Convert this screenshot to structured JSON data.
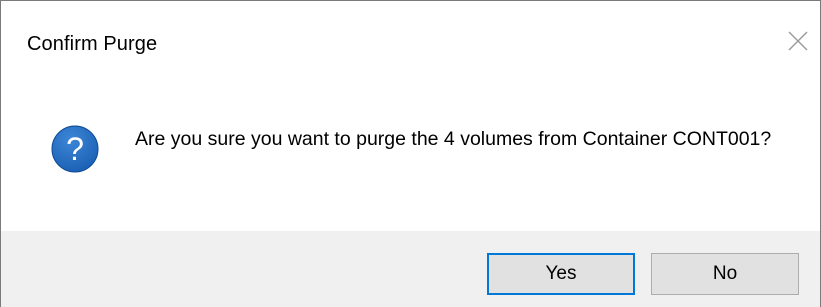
{
  "dialog": {
    "title": "Confirm Purge",
    "icon": "question-icon",
    "message": "Are you sure you want to purge the 4 volumes from Container CONT001?",
    "buttons": {
      "yes_label": "Yes",
      "no_label": "No",
      "default": "yes"
    },
    "colors": {
      "icon_blue": "#1a5fb4",
      "default_button_border": "#0078d7",
      "footer_background": "#f0f0f0"
    }
  }
}
